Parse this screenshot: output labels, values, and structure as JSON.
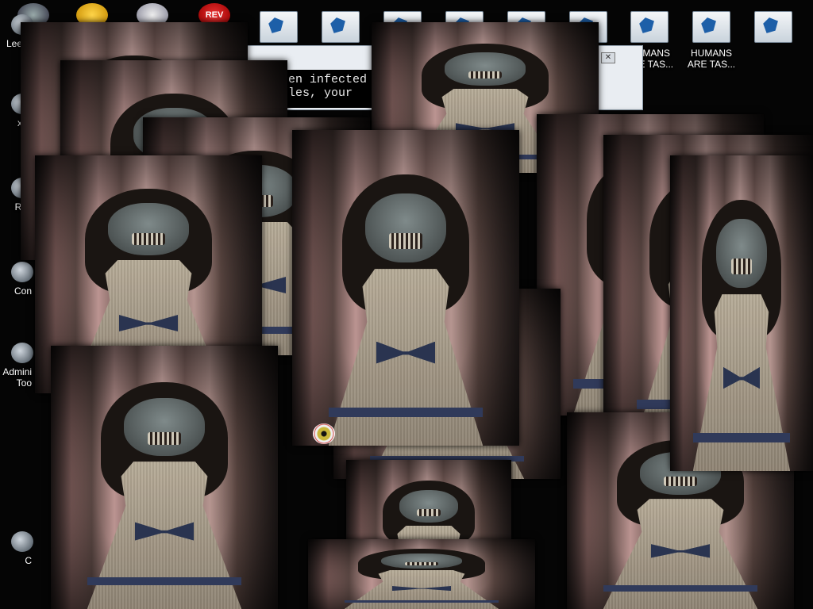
{
  "desktop": {
    "left_icons": [
      {
        "label": "Lee C",
        "icon": "app-icon"
      },
      {
        "label": "x C",
        "icon": "disc-icon"
      },
      {
        "label": "Rec",
        "icon": "recycle-bin-icon"
      },
      {
        "label": "Con",
        "icon": "control-panel-icon"
      },
      {
        "label": "Admini Too",
        "icon": "admin-tools-icon"
      },
      {
        "label": "C",
        "icon": "app-icon"
      }
    ],
    "top_icons": [
      {
        "icon": "gear-icon"
      },
      {
        "icon": "warning-icon"
      },
      {
        "icon": "cog-icon"
      },
      {
        "icon": "rev-icon",
        "text": "REV"
      }
    ],
    "file_icons": [
      {
        "label": "",
        "icon": "document-icon"
      },
      {
        "label": "",
        "icon": "document-icon"
      },
      {
        "label": "",
        "icon": "document-icon"
      },
      {
        "label": "",
        "icon": "document-icon"
      },
      {
        "label": "",
        "icon": "document-icon"
      },
      {
        "label": "",
        "icon": "document-icon"
      },
      {
        "label": "HUMANS ARE TAS...",
        "icon": "document-icon"
      },
      {
        "label": "HUMANS ARE TAS...",
        "icon": "document-icon"
      },
      {
        "label": "",
        "icon": "document-icon"
      }
    ]
  },
  "console": {
    "line1": "been infected",
    "line2": "rules, your"
  },
  "dialog": {
    "close_label": "✕"
  },
  "colors": {
    "background": "#050505",
    "console_bg": "#000000",
    "console_text": "#e8e8e8",
    "dress": "#b6ab97",
    "bow": "#2a3450"
  }
}
